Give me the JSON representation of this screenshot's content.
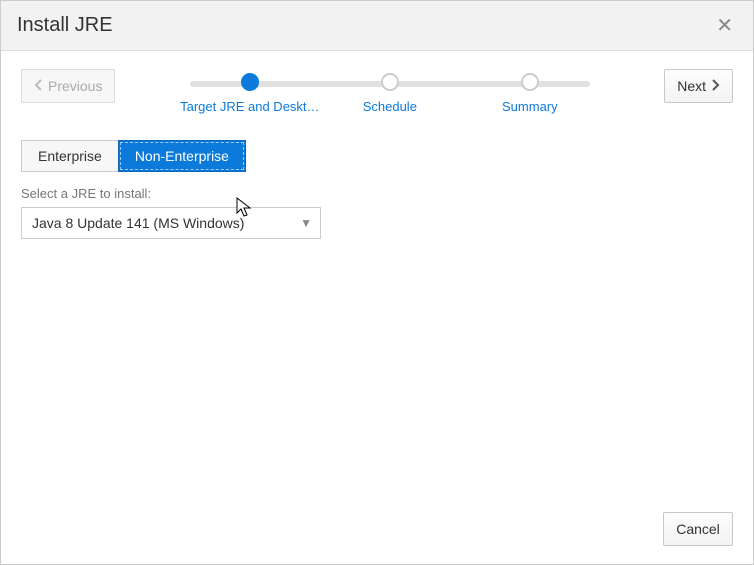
{
  "dialog": {
    "title": "Install JRE"
  },
  "wizard": {
    "prev_label": "Previous",
    "next_label": "Next",
    "steps": {
      "s1": "Target JRE and Deskt…",
      "s2": "Schedule",
      "s3": "Summary"
    }
  },
  "tabs": {
    "enterprise": "Enterprise",
    "non_enterprise": "Non-Enterprise"
  },
  "form": {
    "select_prompt": "Select a JRE to install:",
    "selected_jre": "Java 8 Update 141 (MS Windows)"
  },
  "footer": {
    "cancel": "Cancel"
  }
}
